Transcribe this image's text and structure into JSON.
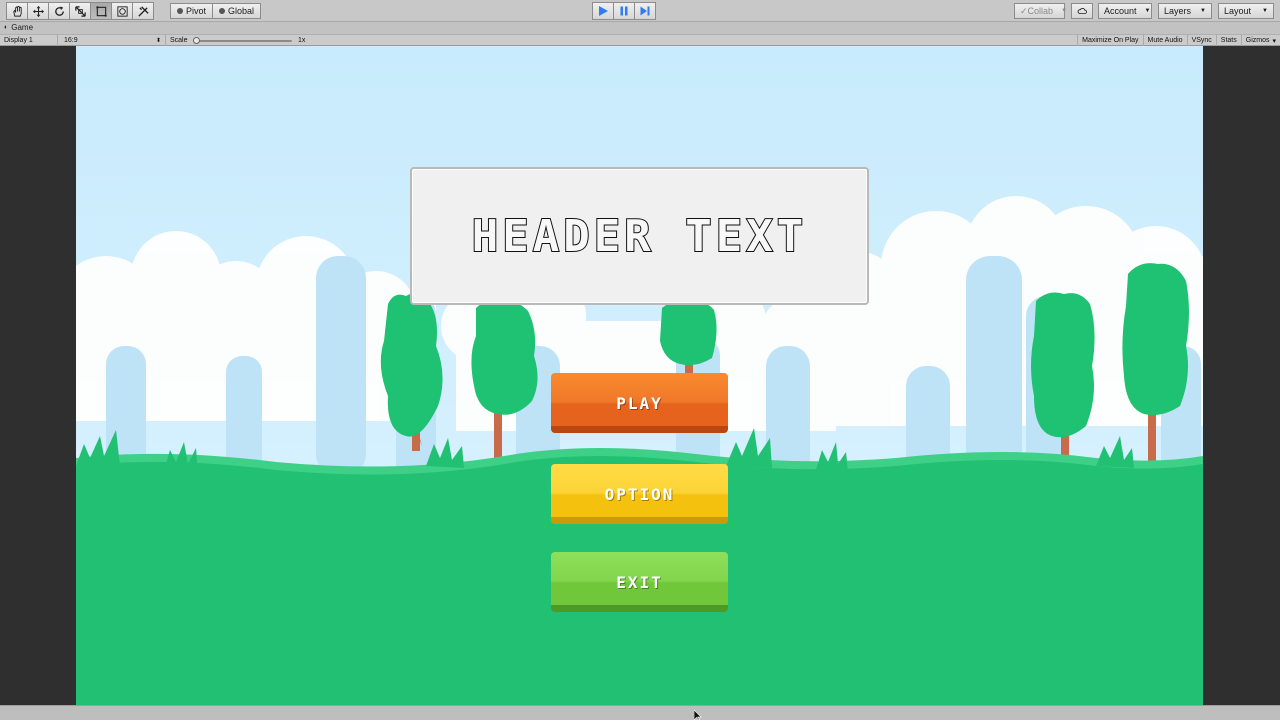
{
  "toolbar": {
    "pivot_label": "Pivot",
    "global_label": "Global",
    "collab_label": "Collab",
    "account_label": "Account",
    "layers_label": "Layers",
    "layout_label": "Layout"
  },
  "game_tab": {
    "label": "Game"
  },
  "game_controls": {
    "display_label": "Display 1",
    "aspect_label": "16:9",
    "scale_label": "Scale",
    "scale_value": "1x",
    "maximize_label": "Maximize On Play",
    "mute_label": "Mute Audio",
    "vsync_label": "VSync",
    "stats_label": "Stats",
    "gizmos_label": "Gizmos"
  },
  "game_ui": {
    "header_text": "HEADER TEXT",
    "buttons": [
      {
        "label": "PLAY",
        "color": "#f0782a"
      },
      {
        "label": "OPTION",
        "color": "#fbd335"
      },
      {
        "label": "EXIT",
        "color": "#82d54c"
      }
    ]
  },
  "colors": {
    "sky": "#cdeefd",
    "ground": "#22c073",
    "tree": "#1fc172",
    "trunk": "#c86b4a"
  }
}
